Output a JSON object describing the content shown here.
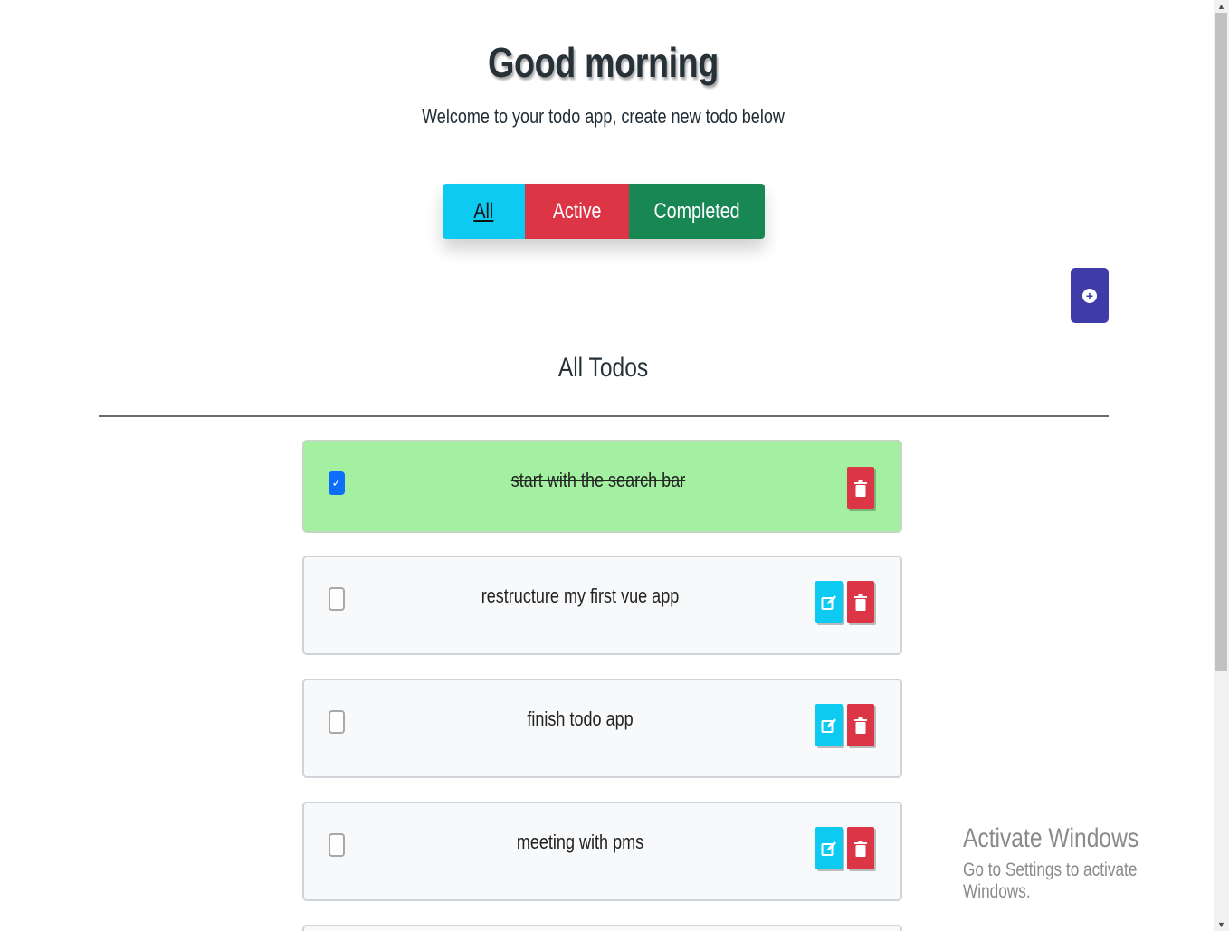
{
  "header": {
    "greeting": "Good morning",
    "subtitle": "Welcome to your todo app, create new todo below"
  },
  "filters": [
    {
      "label": "All",
      "color": "#0dcaf0"
    },
    {
      "label": "Active",
      "color": "#dc3545"
    },
    {
      "label": "Completed",
      "color": "#198754"
    }
  ],
  "add_button": {
    "icon": "plus-circle-icon",
    "color": "#3f3ba8"
  },
  "section_title": "All Todos",
  "todos": [
    {
      "title": "start with the search bar",
      "completed": true
    },
    {
      "title": "restructure my first vue app",
      "completed": false
    },
    {
      "title": "finish todo app",
      "completed": false
    },
    {
      "title": "meeting with pms",
      "completed": false
    }
  ],
  "icons": {
    "edit": "edit-icon",
    "delete": "trash-icon"
  },
  "watermark": {
    "title": "Activate Windows",
    "subtitle": "Go to Settings to activate Windows."
  }
}
